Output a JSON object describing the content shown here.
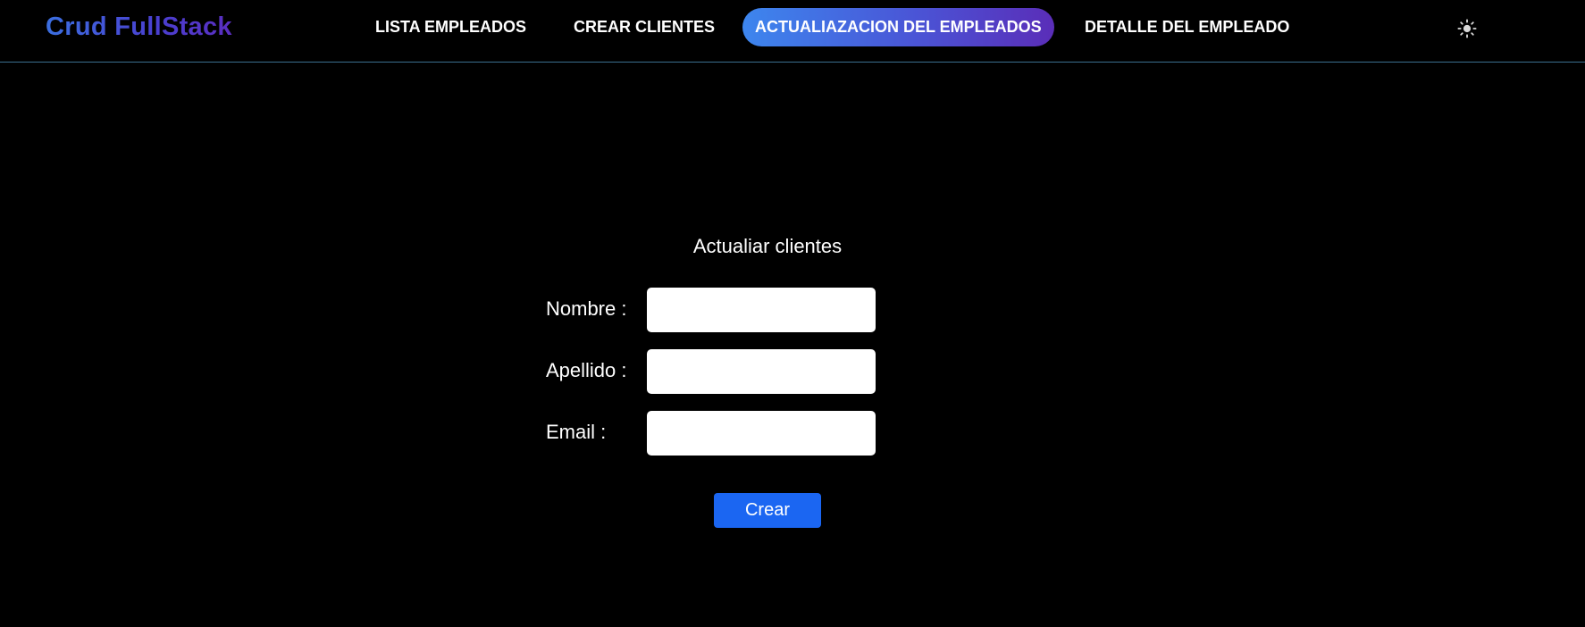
{
  "nav": {
    "brand": "Crud FullStack",
    "items": [
      {
        "label": "LISTA EMPLEADOS",
        "active": false
      },
      {
        "label": "CREAR CLIENTES",
        "active": false
      },
      {
        "label": "ACTUALIAZACION DEL EMPLEADOS",
        "active": true
      },
      {
        "label": "DETALLE DEL EMPLEADO",
        "active": false
      }
    ],
    "theme_icon": "sun-icon"
  },
  "form": {
    "title": "Actualiar clientes",
    "fields": [
      {
        "label": "Nombre :",
        "value": "",
        "placeholder": ""
      },
      {
        "label": "Apellido :",
        "value": "",
        "placeholder": ""
      },
      {
        "label": "Email :",
        "value": "",
        "placeholder": ""
      }
    ],
    "submit_label": "Crear"
  },
  "colors": {
    "background": "#000000",
    "accent_button": "#1b66f2",
    "active_gradient_start": "#3d86ee",
    "active_gradient_end": "#5a2db8",
    "brand_gradient_start": "#3b6fe0",
    "brand_gradient_end": "#5a2ec0"
  }
}
